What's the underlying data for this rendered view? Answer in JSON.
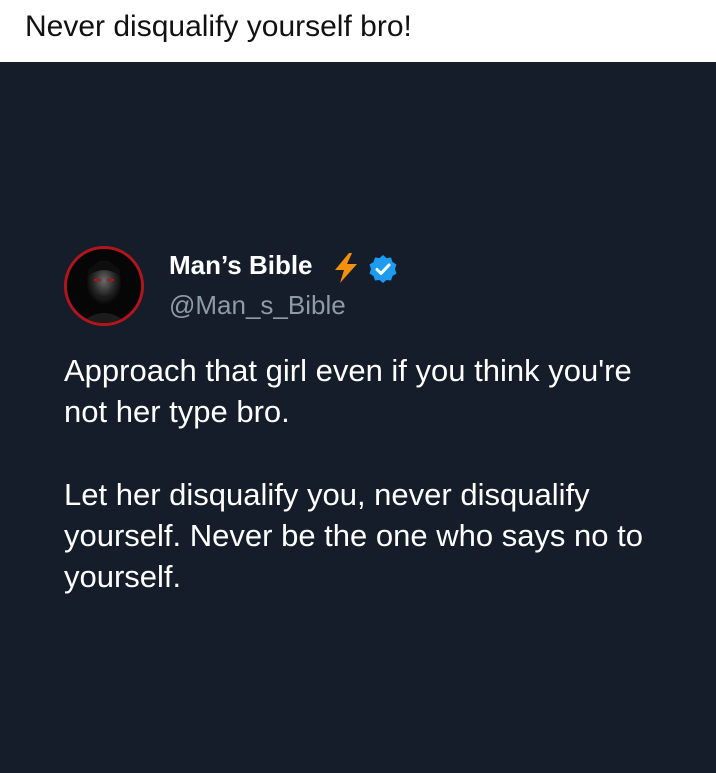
{
  "caption": "Never disqualify yourself bro!",
  "tweet": {
    "display_name": "Man’s Bible",
    "handle": "@Man_s_Bible",
    "name_emoji_icon": "lightning-bolt-icon",
    "verified_icon": "verified-badge-icon",
    "avatar_icon": "profile-photo",
    "paragraphs": [
      "Approach that girl even if you think you're not her type bro.",
      "Let her disqualify you, never disqualify yourself. Never be the one who says no to yourself."
    ]
  },
  "colors": {
    "panel_background": "#141d29",
    "caption_background": "#ffffff",
    "avatar_border": "#b3151c",
    "verified_blue": "#1d9bf0",
    "bolt_orange": "#f4900c",
    "handle_gray": "#8e9aa6"
  }
}
